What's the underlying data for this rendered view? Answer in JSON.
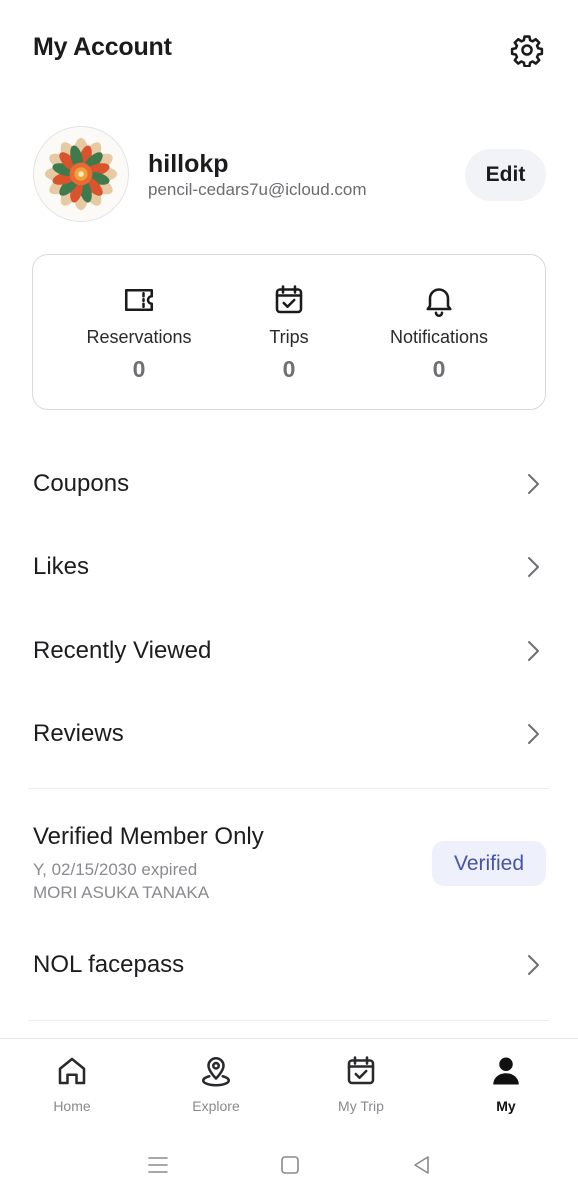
{
  "header": {
    "title": "My Account",
    "settings_icon": "gear-icon"
  },
  "profile": {
    "username": "hillokp",
    "email": "pencil-cedars7u@icloud.com",
    "edit_label": "Edit",
    "avatar_icon": "flower-mandala-avatar"
  },
  "stats": [
    {
      "label": "Reservations",
      "count": "0",
      "icon": "ticket-icon"
    },
    {
      "label": "Trips",
      "count": "0",
      "icon": "calendar-check-icon"
    },
    {
      "label": "Notifications",
      "count": "0",
      "icon": "bell-icon"
    }
  ],
  "menu": [
    {
      "label": "Coupons"
    },
    {
      "label": "Likes"
    },
    {
      "label": "Recently Viewed"
    },
    {
      "label": "Reviews"
    }
  ],
  "verified": {
    "title": "Verified Member Only",
    "expiry": "Y, 02/15/2030 expired",
    "name": "MORI ASUKA TANAKA",
    "badge": "Verified"
  },
  "facepass": {
    "label": "NOL facepass"
  },
  "tabs": [
    {
      "label": "Home",
      "icon": "home-icon",
      "active": false
    },
    {
      "label": "Explore",
      "icon": "location-pin-icon",
      "active": false
    },
    {
      "label": "My Trip",
      "icon": "calendar-check-icon",
      "active": false
    },
    {
      "label": "My",
      "icon": "person-icon",
      "active": true
    }
  ],
  "colors": {
    "accent_badge_bg": "#eef0fb",
    "accent_badge_text": "#4654a8",
    "muted_text": "#8a8a8f"
  }
}
